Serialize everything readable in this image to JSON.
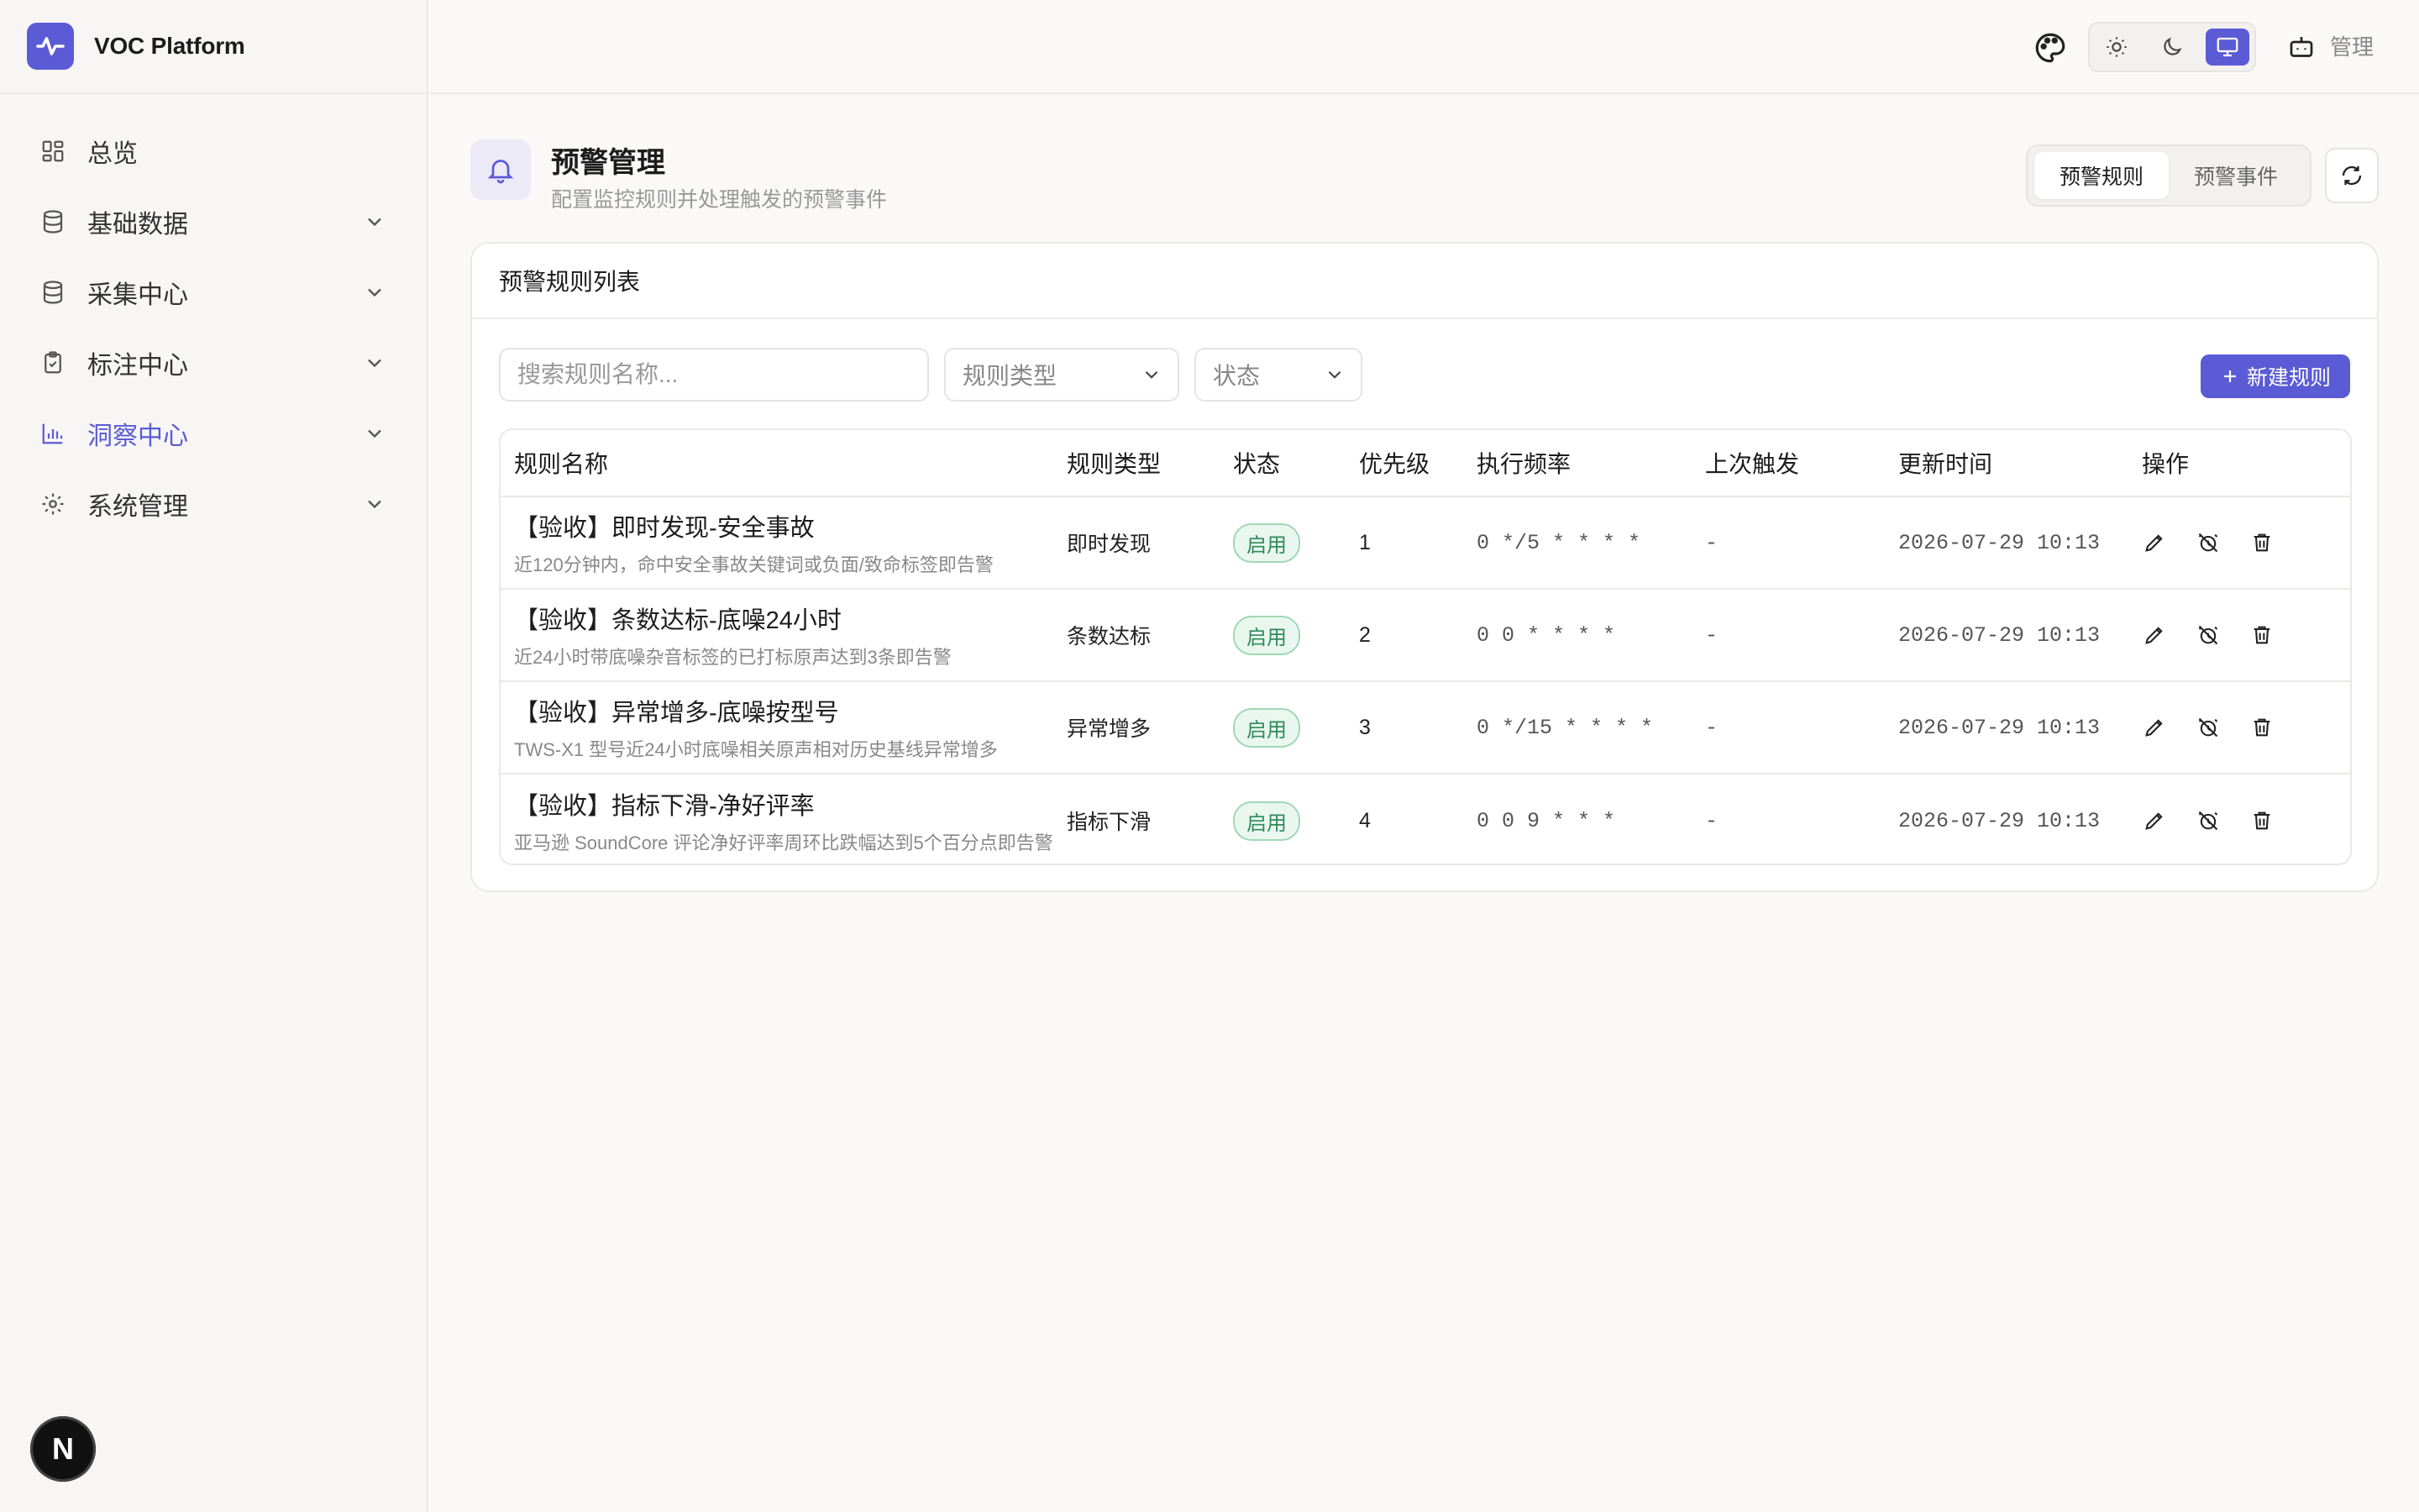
{
  "app": {
    "brand": "VOC Platform",
    "next_badge": "N"
  },
  "sidebar": {
    "items": [
      {
        "label": "总览",
        "icon": "dashboard-icon",
        "expandable": false,
        "active": false
      },
      {
        "label": "基础数据",
        "icon": "database-icon",
        "expandable": true,
        "active": false
      },
      {
        "label": "采集中心",
        "icon": "database-icon",
        "expandable": true,
        "active": false
      },
      {
        "label": "标注中心",
        "icon": "clipboard-check-icon",
        "expandable": true,
        "active": false
      },
      {
        "label": "洞察中心",
        "icon": "bar-chart-icon",
        "expandable": true,
        "active": true
      },
      {
        "label": "系统管理",
        "icon": "gear-icon",
        "expandable": true,
        "active": false
      }
    ]
  },
  "topbar": {
    "theme_options": [
      "sun-icon",
      "moon-icon",
      "monitor-icon"
    ],
    "active_theme": "monitor-icon",
    "user_label": "管理"
  },
  "page": {
    "title": "预警管理",
    "subtitle": "配置监控规则并处理触发的预警事件",
    "tabs": [
      {
        "label": "预警规则",
        "active": true
      },
      {
        "label": "预警事件",
        "active": false
      }
    ]
  },
  "card": {
    "title": "预警规则列表",
    "search_placeholder": "搜索规则名称...",
    "type_select": "规则类型",
    "status_select": "状态",
    "new_button": "新建规则"
  },
  "table": {
    "headers": {
      "name": "规则名称",
      "type": "规则类型",
      "status": "状态",
      "priority": "优先级",
      "freq": "执行频率",
      "last": "上次触发",
      "updated": "更新时间",
      "ops": "操作"
    },
    "rows": [
      {
        "name": "【验收】即时发现-安全事故",
        "desc": "近120分钟内，命中安全事故关键词或负面/致命标签即告警",
        "type": "即时发现",
        "status": "启用",
        "priority": "1",
        "freq": "0 */5 * * * *",
        "last": "-",
        "updated": "2026-07-29 10:13"
      },
      {
        "name": "【验收】条数达标-底噪24小时",
        "desc": "近24小时带底噪杂音标签的已打标原声达到3条即告警",
        "type": "条数达标",
        "status": "启用",
        "priority": "2",
        "freq": "0 0 * * * *",
        "last": "-",
        "updated": "2026-07-29 10:13"
      },
      {
        "name": "【验收】异常增多-底噪按型号",
        "desc": "TWS-X1 型号近24小时底噪相关原声相对历史基线异常增多",
        "type": "异常增多",
        "status": "启用",
        "priority": "3",
        "freq": "0 */15 * * * *",
        "last": "-",
        "updated": "2026-07-29 10:13"
      },
      {
        "name": "【验收】指标下滑-净好评率",
        "desc": "亚马逊 SoundCore 评论净好评率周环比跌幅达到5个百分点即告警",
        "type": "指标下滑",
        "status": "启用",
        "priority": "4",
        "freq": "0 0 9 * * *",
        "last": "-",
        "updated": "2026-07-29 10:13"
      }
    ]
  },
  "colors": {
    "accent": "#5b5bd6",
    "success_text": "#2f8a5b",
    "success_bg": "#eaf7ef"
  }
}
